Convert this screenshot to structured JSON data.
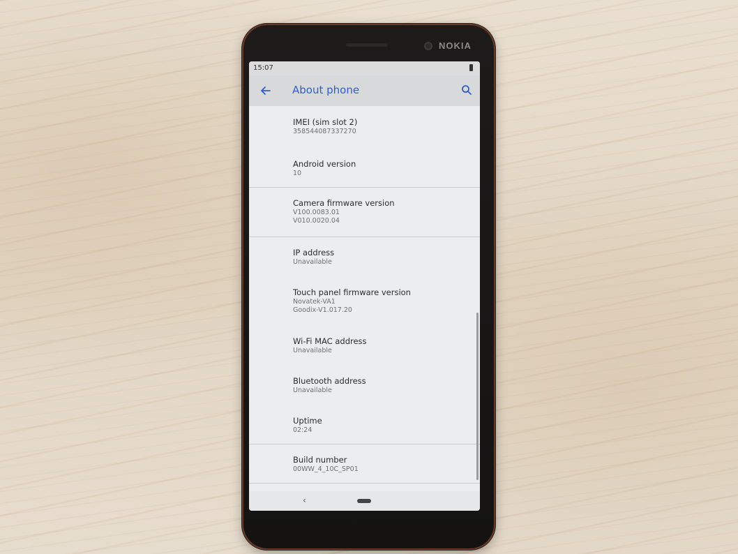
{
  "device": {
    "brand": "NOKIA"
  },
  "status_bar": {
    "time": "15:07"
  },
  "app_bar": {
    "title": "About phone"
  },
  "items": [
    {
      "title": "IMEI (sim slot 2)",
      "value": "358544087337270"
    },
    {
      "title": "Android version",
      "value": "10"
    },
    {
      "title": "Camera firmware version",
      "value": "V100.0083.01",
      "value2": "V010.0020.04"
    },
    {
      "title": "IP address",
      "value": "Unavailable"
    },
    {
      "title": "Touch panel firmware version",
      "value": "Novatek-VA1",
      "value2": "Goodix-V1.017.20"
    },
    {
      "title": "Wi-Fi MAC address",
      "value": "Unavailable"
    },
    {
      "title": "Bluetooth address",
      "value": "Unavailable"
    },
    {
      "title": "Uptime",
      "value": "02:24"
    },
    {
      "title": "Build number",
      "value": "00WW_4_10C_SP01"
    }
  ],
  "nav_bar": {
    "back_glyph": "‹"
  },
  "colors": {
    "accent": "#2f5fc4"
  }
}
